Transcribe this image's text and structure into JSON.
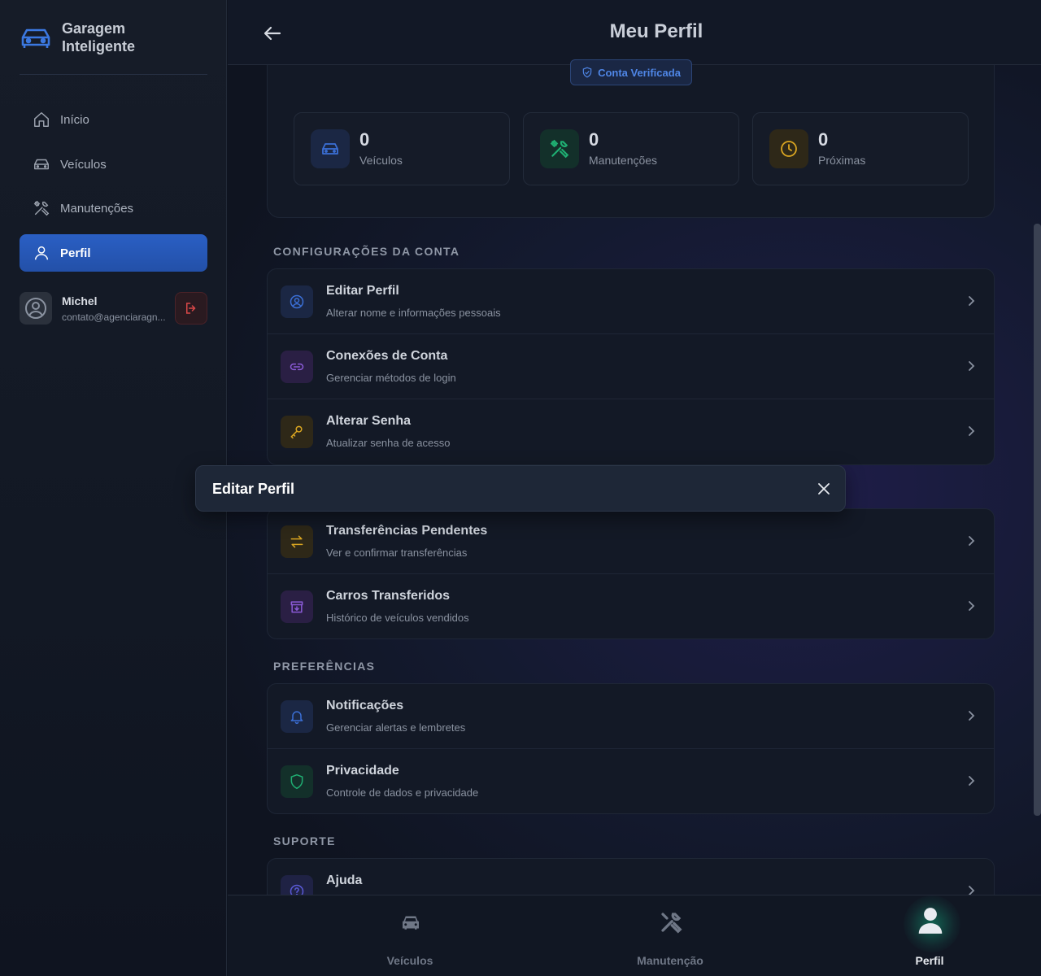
{
  "brand": {
    "name": "Garagem Inteligente",
    "icon": "car-icon"
  },
  "sidebar": {
    "items": [
      {
        "label": "Início",
        "icon": "home-icon"
      },
      {
        "label": "Veículos",
        "icon": "car-icon"
      },
      {
        "label": "Manutenções",
        "icon": "tools-icon"
      },
      {
        "label": "Perfil",
        "icon": "user-icon",
        "active": true
      }
    ],
    "user": {
      "name": "Michel",
      "email": "contato@agenciaragn..."
    }
  },
  "header": {
    "title": "Meu Perfil"
  },
  "profile": {
    "verified_label": "Conta Verificada",
    "stats": [
      {
        "value": "0",
        "label": "Veículos",
        "color": "#3b6fd6"
      },
      {
        "value": "0",
        "label": "Manutenções",
        "color": "#1fae72"
      },
      {
        "value": "0",
        "label": "Próximas",
        "color": "#d9a521"
      }
    ]
  },
  "sections": {
    "account": {
      "title": "CONFIGURAÇÕES DA CONTA",
      "items": [
        {
          "title": "Editar Perfil",
          "subtitle": "Alterar nome e informações pessoais",
          "icon": "user-circle-icon"
        },
        {
          "title": "Conexões de Conta",
          "subtitle": "Gerenciar métodos de login",
          "icon": "link-icon"
        },
        {
          "title": "Alterar Senha",
          "subtitle": "Atualizar senha de acesso",
          "icon": "key-icon"
        }
      ]
    },
    "vehicles": {
      "items": [
        {
          "title": "Transferências Pendentes",
          "subtitle": "Ver e confirmar transferências",
          "icon": "transfer-icon"
        },
        {
          "title": "Carros Transferidos",
          "subtitle": "Histórico de veículos vendidos",
          "icon": "archive-icon"
        }
      ]
    },
    "preferences": {
      "title": "PREFERÊNCIAS",
      "items": [
        {
          "title": "Notificações",
          "subtitle": "Gerenciar alertas e lembretes",
          "icon": "bell-icon"
        },
        {
          "title": "Privacidade",
          "subtitle": "Controle de dados e privacidade",
          "icon": "shield-icon"
        }
      ]
    },
    "support": {
      "title": "SUPORTE",
      "items": [
        {
          "title": "Ajuda",
          "icon": "help-icon"
        }
      ]
    }
  },
  "bottom_nav": [
    {
      "label": "Veículos",
      "icon": "car-icon"
    },
    {
      "label": "Manutenção",
      "icon": "tools-icon"
    },
    {
      "label": "Perfil",
      "icon": "user-icon",
      "active": true
    }
  ],
  "toast": {
    "title": "Editar Perfil"
  }
}
